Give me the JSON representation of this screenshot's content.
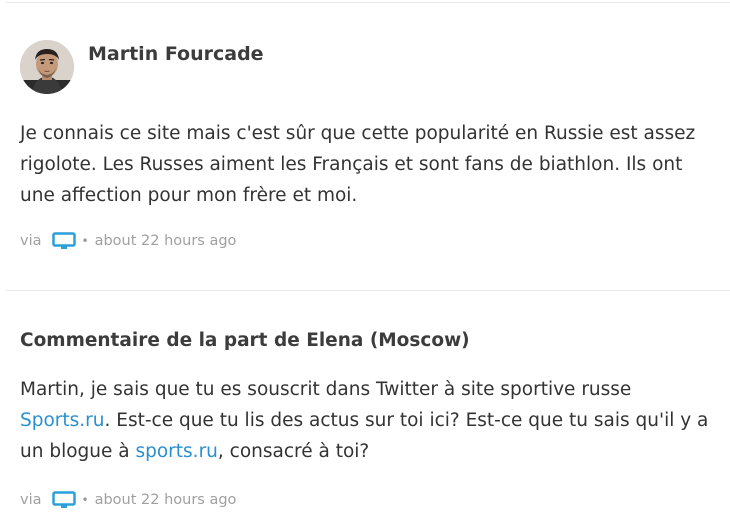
{
  "posts": [
    {
      "author": "Martin Fourcade",
      "body": "Je connais ce site mais c'est sûr que cette popularité en Russie est assez rigolote. Les Russes aiment les Français et sont fans de biathlon. Ils ont une affection pour mon frère et moi.",
      "meta": {
        "via": "via",
        "separator": "•",
        "time": "about 22 hours ago",
        "device_icon": "desktop-icon"
      }
    },
    {
      "title": "Commentaire de la part de Elena (Moscow)",
      "body_parts": {
        "part1": "Martin, je sais que tu es souscrit dans Twitter à site sportive russe ",
        "link1": "Sports.ru",
        "part2": ". Est-ce que tu lis des actus sur toi ici? Est-ce que tu sais qu'il y a un blogue à ",
        "link2": "sports.ru",
        "part3": ", consacré à toi?"
      },
      "meta": {
        "via": "via",
        "separator": "•",
        "time": "about 22 hours ago",
        "device_icon": "desktop-icon"
      }
    }
  ],
  "colors": {
    "link": "#2a8fd0",
    "icon": "#2a9fd8",
    "meta_text": "#a0a0a0",
    "divider": "#ececec"
  }
}
